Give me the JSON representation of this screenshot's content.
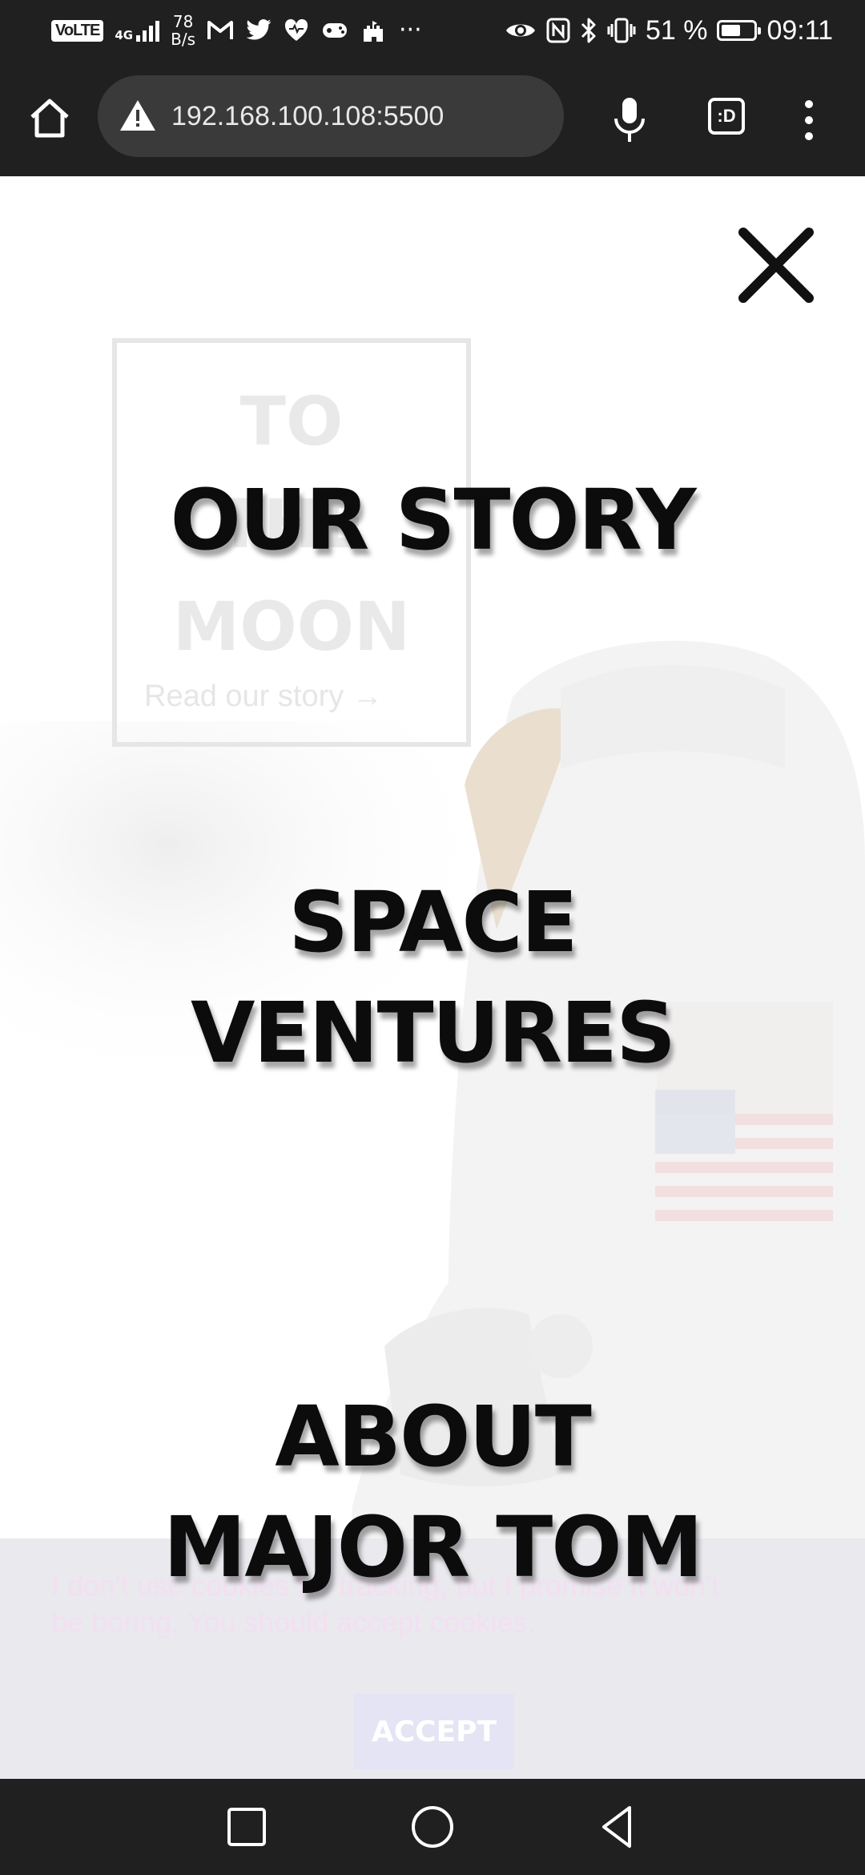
{
  "status_bar": {
    "volte": "VoLTE",
    "network": "4G",
    "speed_value": "78",
    "speed_unit": "B/s",
    "more": "···",
    "battery_text": "51 %",
    "time": "09:11",
    "icons": [
      "gmail-icon",
      "twitter-icon",
      "health-icon",
      "game-icon",
      "castle-icon",
      "eye-icon",
      "nfc-icon",
      "bluetooth-icon",
      "vibrate-icon",
      "battery-icon"
    ]
  },
  "browser": {
    "url": "192.168.100.108:5500",
    "tabs_label": ":D",
    "icons": [
      "home-icon",
      "warning-icon",
      "mic-icon",
      "tabs-icon",
      "menu-icon"
    ]
  },
  "hero": {
    "title_line1": "TO",
    "title_line2": "THE",
    "title_line3": "MOON",
    "link": "Read our story →"
  },
  "menu": {
    "items": [
      {
        "label": "OUR STORY"
      },
      {
        "label": "SPACE\nVENTURES"
      },
      {
        "label": "ABOUT\nMAJOR TOM"
      }
    ]
  },
  "cookie": {
    "text": "I don't use cookies for tracking, but I promise it won't be boring. You should accept cookies.",
    "accept_label": "ACCEPT"
  },
  "colors": {
    "chrome": "#202020",
    "url_bar": "#3a3a3a",
    "menu_text": "#0c0c0c"
  }
}
